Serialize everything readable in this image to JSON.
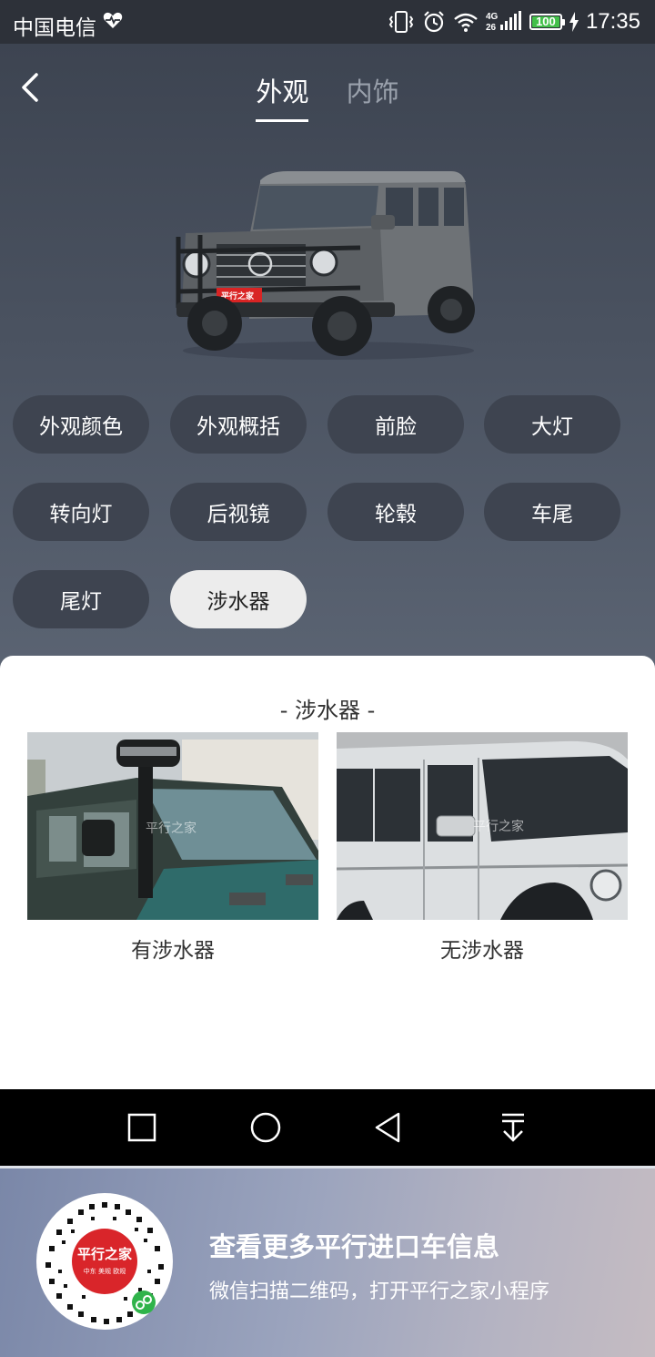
{
  "status_bar": {
    "carrier": "中国电信",
    "network": "4G",
    "network2": "26",
    "battery": "100",
    "time": "17:35"
  },
  "header": {
    "tabs": [
      {
        "label": "外观",
        "active": true
      },
      {
        "label": "内饰",
        "active": false
      }
    ]
  },
  "car": {
    "watermark": "平行之家"
  },
  "categories": [
    {
      "label": "外观颜色",
      "active": false
    },
    {
      "label": "外观概括",
      "active": false
    },
    {
      "label": "前脸",
      "active": false
    },
    {
      "label": "大灯",
      "active": false
    },
    {
      "label": "转向灯",
      "active": false
    },
    {
      "label": "后视镜",
      "active": false
    },
    {
      "label": "轮毂",
      "active": false
    },
    {
      "label": "车尾",
      "active": false
    },
    {
      "label": "尾灯",
      "active": false
    },
    {
      "label": "涉水器",
      "active": true
    }
  ],
  "detail": {
    "title": "- 涉水器 -",
    "items": [
      {
        "caption": "有涉水器",
        "watermark": "平行之家"
      },
      {
        "caption": "无涉水器",
        "watermark": "平行之家"
      }
    ]
  },
  "promo": {
    "title": "查看更多平行进口车信息",
    "subtitle": "微信扫描二维码，打开平行之家小程序",
    "qr_brand": "平行之家",
    "qr_tagline": "中东 美规 欧规"
  },
  "colors": {
    "accent_active_chip": "#ececec",
    "chip": "#3e4450",
    "battery": "#43c04a"
  },
  "icons": [
    "back-icon",
    "heart-icon",
    "vibrate-icon",
    "alarm-icon",
    "wifi-icon",
    "signal-icon",
    "battery-icon",
    "charging-icon",
    "square-nav-icon",
    "circle-nav-icon",
    "triangle-nav-icon",
    "download-nav-icon",
    "mini-program-icon"
  ]
}
